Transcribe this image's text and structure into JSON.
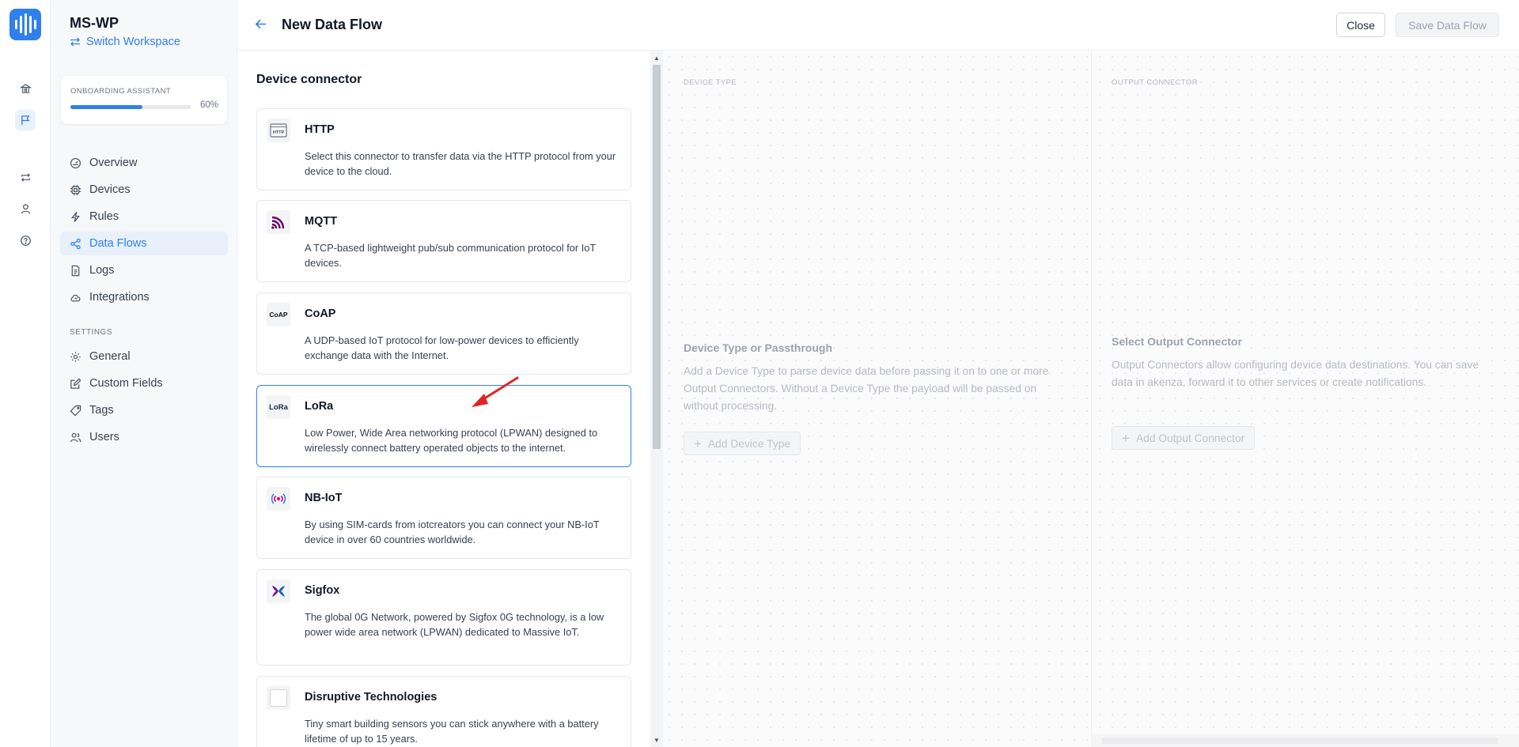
{
  "workspace": {
    "name": "MS-WP",
    "switch_label": "Switch Workspace"
  },
  "onboarding": {
    "title": "ONBOARDING ASSISTANT",
    "progress_label": "60%",
    "progress": 0.6
  },
  "nav": {
    "items": [
      {
        "label": "Overview",
        "icon": "gauge-icon"
      },
      {
        "label": "Devices",
        "icon": "chip-icon"
      },
      {
        "label": "Rules",
        "icon": "lightning-icon"
      },
      {
        "label": "Data Flows",
        "icon": "share-icon",
        "active": true
      },
      {
        "label": "Logs",
        "icon": "log-file-icon"
      },
      {
        "label": "Integrations",
        "icon": "cloud-icon"
      }
    ],
    "settings_label": "SETTINGS",
    "settings_items": [
      {
        "label": "General",
        "icon": "gear-icon"
      },
      {
        "label": "Custom Fields",
        "icon": "edit-icon"
      },
      {
        "label": "Tags",
        "icon": "tag-icon"
      },
      {
        "label": "Users",
        "icon": "users-icon"
      }
    ]
  },
  "header": {
    "title": "New Data Flow",
    "close_label": "Close",
    "save_label": "Save Data Flow"
  },
  "connectors": {
    "title": "Device connector",
    "items": [
      {
        "name": "HTTP",
        "description": "Select this connector to transfer data via the HTTP protocol from your device to the cloud.",
        "icon": "http-icon"
      },
      {
        "name": "MQTT",
        "description": "A TCP-based lightweight pub/sub communication protocol for IoT devices.",
        "icon": "mqtt-icon"
      },
      {
        "name": "CoAP",
        "description": "A UDP-based IoT protocol for low-power devices to efficiently exchange data with the Internet.",
        "icon": "coap-icon",
        "icon_text": "CoAP"
      },
      {
        "name": "LoRa",
        "description": "Low Power, Wide Area networking protocol (LPWAN) designed to wirelessly connect battery operated objects to the internet.",
        "icon": "lora-icon",
        "icon_text": "LoRa",
        "selected": true
      },
      {
        "name": "NB-IoT",
        "description": "By using SIM-cards from iotcreators you can connect your NB-IoT device in over 60 countries worldwide.",
        "icon": "nbiot-icon"
      },
      {
        "name": "Sigfox",
        "description": "The global 0G Network, powered by Sigfox 0G technology, is a low power wide area network (LPWAN) dedicated to Massive IoT.",
        "icon": "sigfox-icon"
      },
      {
        "name": "Disruptive Technologies",
        "description": "Tiny smart building sensors you can stick anywhere with a battery lifetime of up to 15 years.",
        "icon": "disruptive-icon"
      }
    ]
  },
  "flow": {
    "device_type": {
      "label": "DEVICE TYPE",
      "title": "Device Type or Passthrough",
      "description": "Add a Device Type to parse device data before passing it on to one or more Output Connectors. Without a Device Type the payload will be passed on without processing.",
      "button": "Add Device Type"
    },
    "output": {
      "label": "OUTPUT CONNECTOR",
      "title": "Select Output Connector",
      "description": "Output Connectors allow configuring device data destinations. You can save data in akenza, forward it to other services or create notifications.",
      "button": "Add Output Connector"
    }
  },
  "colors": {
    "accent": "#2f80ed",
    "annotation_arrow": "#e02424"
  }
}
